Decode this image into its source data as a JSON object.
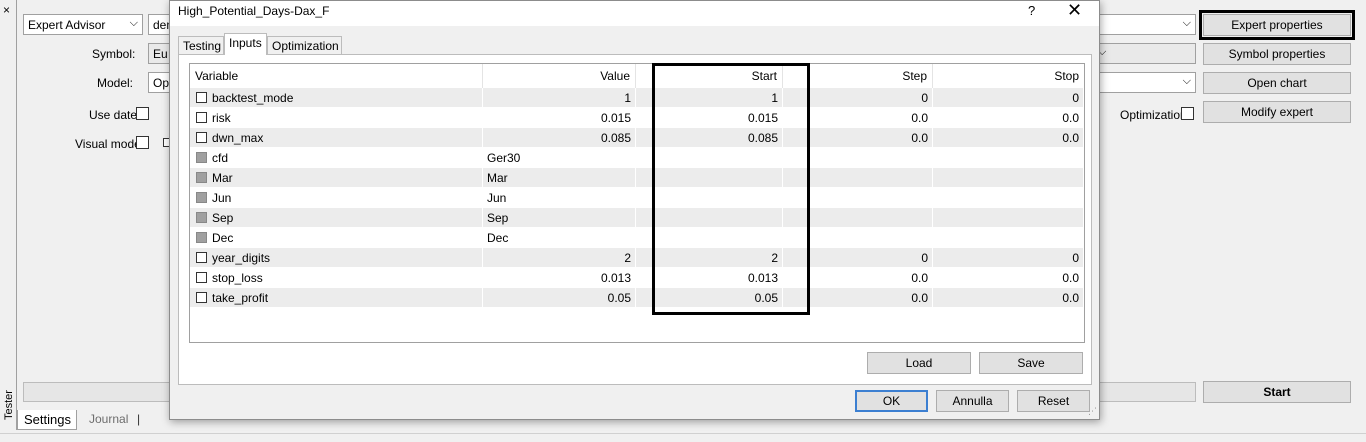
{
  "tester": {
    "close_glyph": "×",
    "vertical_label": "Tester",
    "expert_type": "Expert Advisor",
    "expert_file_partial": "den",
    "symbol_label": "Symbol:",
    "symbol_partial": "Eu",
    "model_label": "Model:",
    "model_partial": "Op",
    "use_date_label": "Use date",
    "visual_mode_label": "Visual mode",
    "optimization_label": "Optimization",
    "buttons": {
      "expert_properties": "Expert properties",
      "symbol_properties": "Symbol properties",
      "open_chart": "Open chart",
      "modify_expert": "Modify expert",
      "start": "Start"
    },
    "bottom_tabs": [
      "Settings",
      "Journal"
    ],
    "separator": "|"
  },
  "dialog": {
    "title": "High_Potential_Days-Dax_F",
    "help": "?",
    "close": "✕",
    "tabs": [
      "Testing",
      "Inputs",
      "Optimization"
    ],
    "active_tab": "Inputs",
    "columns": [
      "Variable",
      "Value",
      "Start",
      "Step",
      "Stop"
    ],
    "rows": [
      {
        "variable": "backtest_mode",
        "value": "1",
        "start": "1",
        "step": "0",
        "stop": "0",
        "optimizable": true
      },
      {
        "variable": "risk",
        "value": "0.015",
        "start": "0.015",
        "step": "0.0",
        "stop": "0.0",
        "optimizable": true
      },
      {
        "variable": "dwn_max",
        "value": "0.085",
        "start": "0.085",
        "step": "0.0",
        "stop": "0.0",
        "optimizable": true
      },
      {
        "variable": "cfd",
        "value": "Ger30",
        "start": "",
        "step": "",
        "stop": "",
        "optimizable": false
      },
      {
        "variable": "Mar",
        "value": "Mar",
        "start": "",
        "step": "",
        "stop": "",
        "optimizable": false
      },
      {
        "variable": "Jun",
        "value": "Jun",
        "start": "",
        "step": "",
        "stop": "",
        "optimizable": false
      },
      {
        "variable": "Sep",
        "value": "Sep",
        "start": "",
        "step": "",
        "stop": "",
        "optimizable": false
      },
      {
        "variable": "Dec",
        "value": "Dec",
        "start": "",
        "step": "",
        "stop": "",
        "optimizable": false
      },
      {
        "variable": "year_digits",
        "value": "2",
        "start": "2",
        "step": "0",
        "stop": "0",
        "optimizable": true
      },
      {
        "variable": "stop_loss",
        "value": "0.013",
        "start": "0.013",
        "step": "0.0",
        "stop": "0.0",
        "optimizable": true
      },
      {
        "variable": "take_profit",
        "value": "0.05",
        "start": "0.05",
        "step": "0.0",
        "stop": "0.0",
        "optimizable": true
      }
    ],
    "buttons": {
      "load": "Load",
      "save": "Save",
      "ok": "OK",
      "cancel": "Annulla",
      "reset": "Reset"
    }
  },
  "colors": {
    "panel_bg": "#f0f0f0",
    "alt_row": "#ececec",
    "highlight_border": "#000000",
    "ok_focus": "#3c7fd1"
  }
}
